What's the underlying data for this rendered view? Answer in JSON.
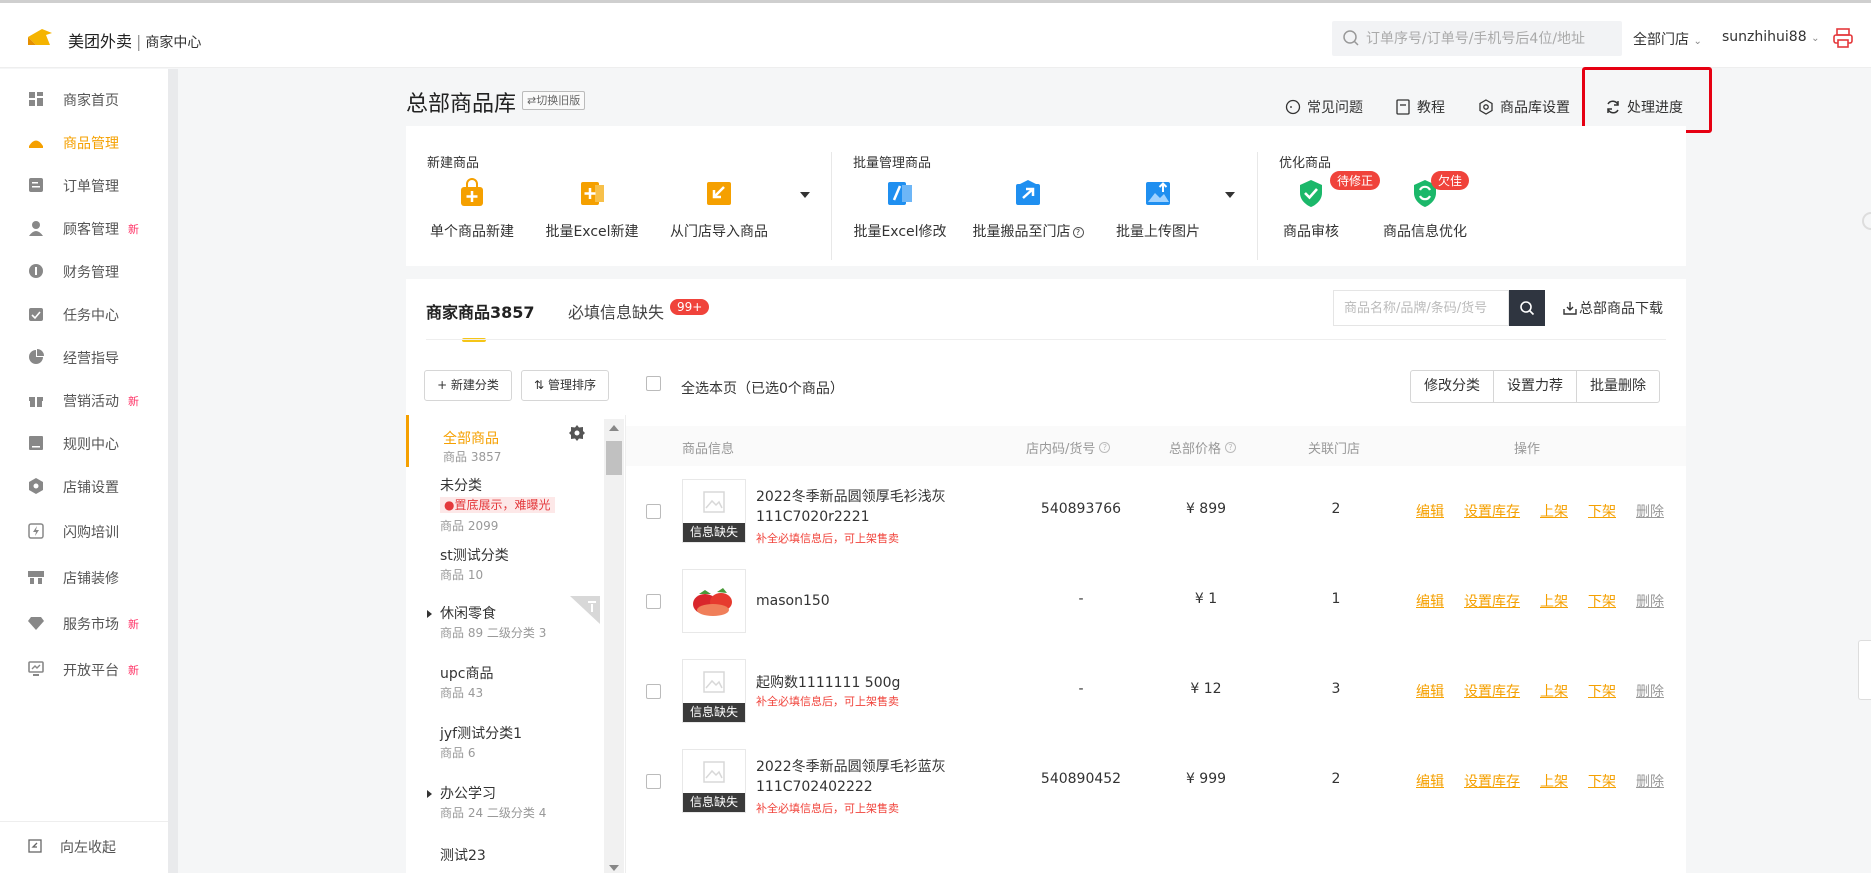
{
  "header": {
    "brand": "美团外卖",
    "brand_sub": "商家中心",
    "search_placeholder": "订单序号/订单号/手机号后4位/地址",
    "store_selector": "全部门店",
    "username": "sunzhihui88"
  },
  "sidebar": {
    "items": [
      {
        "label": "商家首页",
        "icon": "dashboard-icon",
        "new": ""
      },
      {
        "label": "商品管理",
        "icon": "product-icon",
        "new": ""
      },
      {
        "label": "订单管理",
        "icon": "order-icon",
        "new": ""
      },
      {
        "label": "顾客管理",
        "icon": "customer-icon",
        "new": "新"
      },
      {
        "label": "财务管理",
        "icon": "finance-icon",
        "new": ""
      },
      {
        "label": "任务中心",
        "icon": "task-icon",
        "new": ""
      },
      {
        "label": "经营指导",
        "icon": "guide-icon",
        "new": ""
      },
      {
        "label": "营销活动",
        "icon": "gift-icon",
        "new": "新"
      },
      {
        "label": "规则中心",
        "icon": "rules-icon",
        "new": ""
      },
      {
        "label": "店铺设置",
        "icon": "shop-settings-icon",
        "new": ""
      },
      {
        "label": "闪购培训",
        "icon": "training-icon",
        "new": ""
      },
      {
        "label": "店铺装修",
        "icon": "decoration-icon",
        "new": ""
      },
      {
        "label": "服务市场",
        "icon": "market-icon",
        "new": "新"
      },
      {
        "label": "开放平台",
        "icon": "open-platform-icon",
        "new": "新"
      }
    ],
    "active": "商品管理",
    "collapse_label": "向左收起"
  },
  "page": {
    "title": "总部商品库",
    "switch_old": "切换旧版",
    "links": {
      "faq": "常见问题",
      "tutorial": "教程",
      "settings": "商品库设置",
      "progress": "处理进度"
    }
  },
  "actions": {
    "new_section": "新建商品",
    "batch_section": "批量管理商品",
    "optimize_section": "优化商品",
    "new_single": "单个商品新建",
    "new_excel": "批量Excel新建",
    "import_store": "从门店导入商品",
    "batch_excel_edit": "批量Excel修改",
    "batch_move": "批量搬品至门店",
    "batch_upload_img": "批量上传图片",
    "audit": "商品审核",
    "audit_badge": "待修正",
    "info_optimize": "商品信息优化",
    "info_badge": "欠佳"
  },
  "product_area": {
    "tab_main": "商家商品3857",
    "tab_sub": "必填信息缺失",
    "tab_sub_badge": "99+",
    "search_placeholder": "商品名称/品牌/条码/货号",
    "download": "总部商品下载",
    "new_category": "+ 新建分类",
    "sort_category": "管理排序",
    "select_all": "全选本页（已选0个商品）",
    "bulk_buttons": [
      "修改分类",
      "设置力荐",
      "批量删除"
    ]
  },
  "categories": [
    {
      "name": "全部商品",
      "count": "商品 3857",
      "warn": "",
      "expandable": false
    },
    {
      "name": "未分类",
      "count": "商品 2099",
      "warn": "置底展示，难曝光",
      "expandable": false
    },
    {
      "name": "st测试分类",
      "count": "商品 10",
      "warn": "",
      "expandable": false
    },
    {
      "name": "休闲零食",
      "count": "商品 89 二级分类 3",
      "warn": "",
      "expandable": true
    },
    {
      "name": "upc商品",
      "count": "商品 43",
      "warn": "",
      "expandable": false
    },
    {
      "name": "jyf测试分类1",
      "count": "商品 6",
      "warn": "",
      "expandable": false
    },
    {
      "name": "办公学习",
      "count": "商品 24 二级分类 4",
      "warn": "",
      "expandable": true
    },
    {
      "name": "测试23",
      "count": "",
      "warn": "",
      "expandable": false
    }
  ],
  "table": {
    "headers": {
      "info": "商品信息",
      "code": "店内码/货号",
      "price": "总部价格",
      "stores": "关联门店",
      "ops": "操作"
    },
    "missing_label": "信息缺失",
    "ops": [
      "编辑",
      "设置库存",
      "上架",
      "下架",
      "删除"
    ],
    "rows": [
      {
        "name": "2022冬季新品圆领厚毛衫浅灰111C7020r2221",
        "tip": "补全必填信息后，可上架售卖",
        "code": "540893766",
        "price": "¥ 899",
        "stores": "2",
        "missing": true
      },
      {
        "name": "mason150",
        "tip": "",
        "code": "-",
        "price": "¥ 1",
        "stores": "1",
        "missing": false
      },
      {
        "name": "起购数1111111 500g",
        "tip": "补全必填信息后，可上架售卖",
        "code": "-",
        "price": "¥ 12",
        "stores": "3",
        "missing": true
      },
      {
        "name": "2022冬季新品圆领厚毛衫蓝灰111C702402222",
        "tip": "补全必填信息后，可上架售卖",
        "code": "540890452",
        "price": "¥ 999",
        "stores": "2",
        "missing": true
      }
    ]
  },
  "colors": {
    "accent": "#f5a000",
    "danger": "#f0433b",
    "highlight_box": "#e60012"
  }
}
